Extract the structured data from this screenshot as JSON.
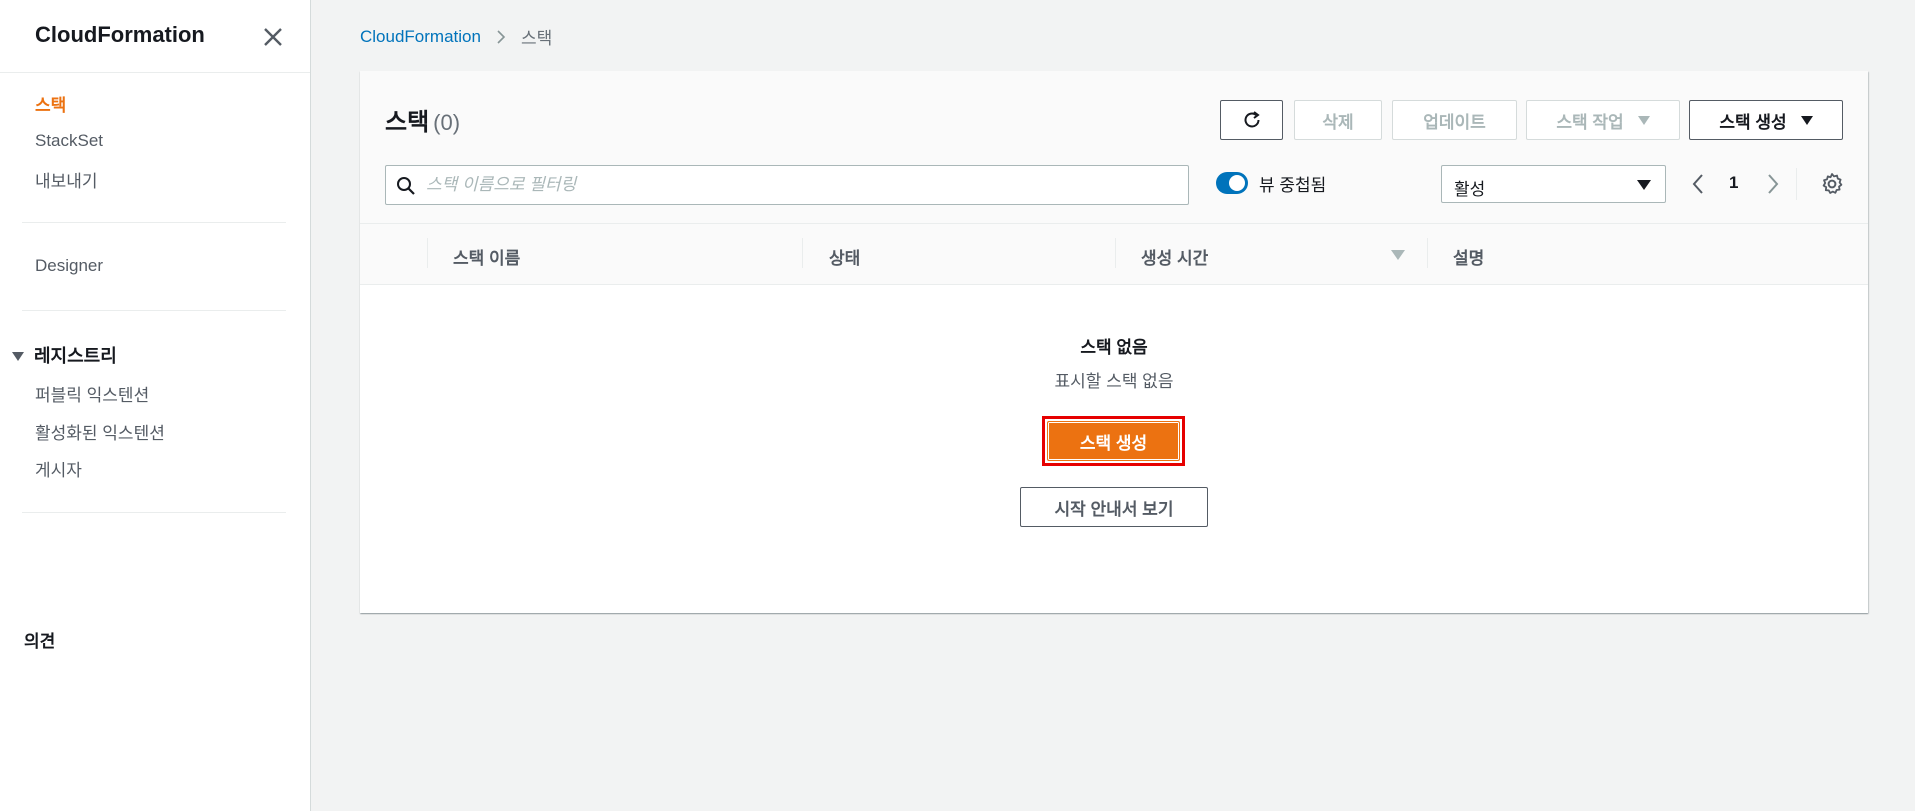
{
  "sidebar": {
    "title": "CloudFormation",
    "items": [
      {
        "label": "스택",
        "active": true
      },
      {
        "label": "StackSet"
      },
      {
        "label": "내보내기"
      },
      {
        "label": "Designer"
      }
    ],
    "registry": {
      "label": "레지스트리",
      "items": [
        {
          "label": "퍼블릭 익스텐션"
        },
        {
          "label": "활성화된 익스텐션"
        },
        {
          "label": "게시자"
        }
      ]
    },
    "feedback": "의견"
  },
  "breadcrumb": {
    "root": "CloudFormation",
    "current": "스택"
  },
  "panel": {
    "title": "스택",
    "count": "(0)",
    "buttons": {
      "delete": "삭제",
      "update": "업데이트",
      "stack_actions": "스택 작업",
      "create_stack": "스택 생성"
    },
    "search": {
      "placeholder": "스택 이름으로 필터링",
      "value": ""
    },
    "toggle": {
      "label": "뷰 중첩됨",
      "on": true
    },
    "status_filter": "활성",
    "page": "1"
  },
  "table": {
    "columns": [
      "스택 이름",
      "상태",
      "생성 시간",
      "설명"
    ]
  },
  "empty": {
    "title": "스택 없음",
    "subtitle": "표시할 스택 없음",
    "create_button": "스택 생성",
    "guide_button": "시작 안내서 보기"
  },
  "colors": {
    "accent": "#ec7211",
    "link": "#0073bb",
    "highlight_border": "#e60000"
  }
}
